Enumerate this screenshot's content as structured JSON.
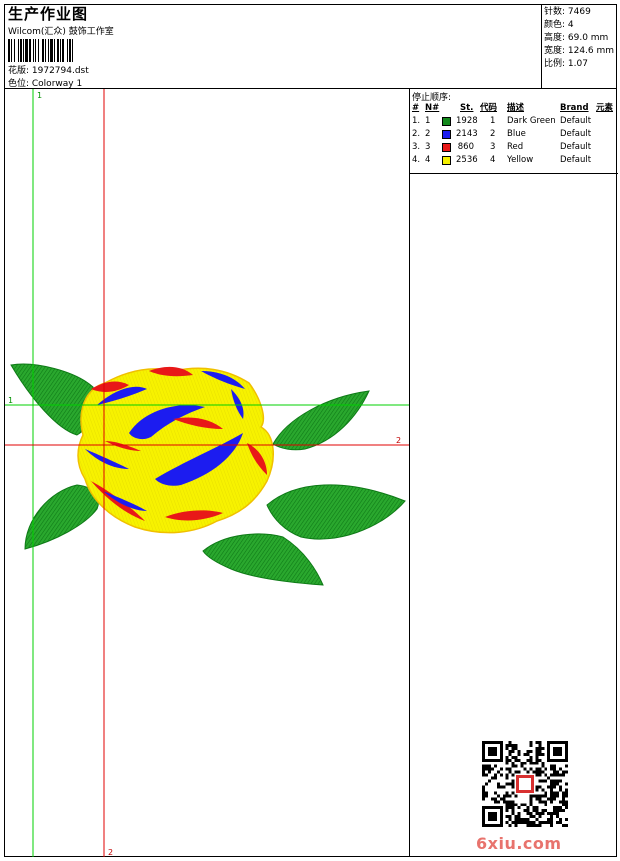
{
  "header": {
    "title": "生产作业图",
    "company": "Wilcom(汇众) 鼓饰工作室",
    "file_label": "花版: 1972794.dst",
    "colorway_label": "色位: Colorway 1"
  },
  "stats": [
    {
      "label": "针数: 7469"
    },
    {
      "label": "颜色: 4"
    },
    {
      "label": "高度: 69.0 mm"
    },
    {
      "label": "宽度: 124.6 mm"
    },
    {
      "label": "比例: 1.07"
    }
  ],
  "stop_sequence": {
    "title": "停止顺序:",
    "headers": {
      "idx": "#",
      "n": "N#",
      "st": "St.",
      "code": "代码",
      "desc": "描述",
      "brand": "Brand",
      "elem": "元素"
    },
    "rows": [
      {
        "idx": "1.",
        "n": "1",
        "color": "#138a1c",
        "st": "1928",
        "code": "1",
        "desc": "Dark Green",
        "brand": "Default"
      },
      {
        "idx": "2.",
        "n": "2",
        "color": "#1c1cf0",
        "st": "2143",
        "code": "2",
        "desc": "Blue",
        "brand": "Default"
      },
      {
        "idx": "3.",
        "n": "3",
        "color": "#e81818",
        "st": "860",
        "code": "3",
        "desc": "Red",
        "brand": "Default"
      },
      {
        "idx": "4.",
        "n": "4",
        "color": "#f5f000",
        "st": "2536",
        "code": "4",
        "desc": "Yellow",
        "brand": "Default"
      }
    ]
  },
  "guides": {
    "green_top": "1",
    "green_left": "1",
    "red_right": "2",
    "red_bottom": "2"
  },
  "watermark": {
    "site": "6xiu.com"
  }
}
